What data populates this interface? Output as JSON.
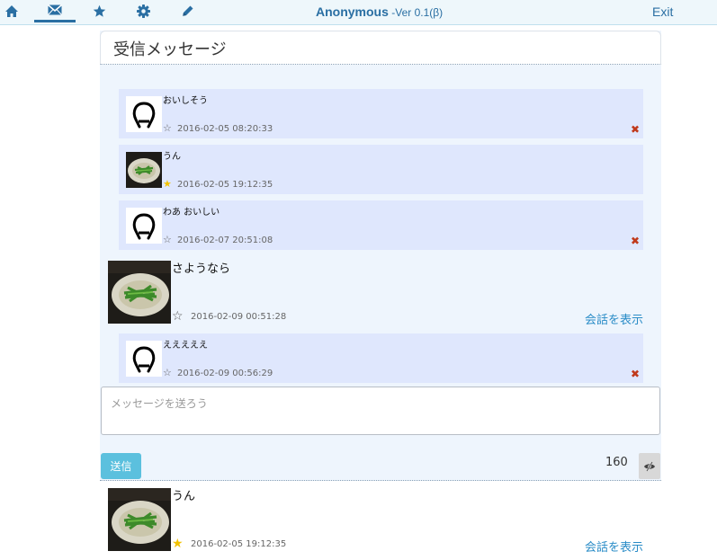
{
  "nav": {
    "icons": [
      "home-icon",
      "mail-icon",
      "star-icon",
      "gear-icon",
      "pencil-icon"
    ],
    "brand": "Anonymous",
    "version": " -Ver 0.1(β)",
    "exit": "Exit"
  },
  "panel": {
    "title": "受信メッセージ"
  },
  "thread": {
    "replies": [
      {
        "text": "おいしそう",
        "date": "2016-02-05 08:20:33",
        "starred": false,
        "deletable": true,
        "avatar": "silhouette"
      },
      {
        "text": "うん",
        "date": "2016-02-05 19:12:35",
        "starred": true,
        "deletable": false,
        "avatar": "photo"
      },
      {
        "text": "わあ おいしい",
        "date": "2016-02-07 20:51:08",
        "starred": false,
        "deletable": true,
        "avatar": "silhouette"
      }
    ],
    "main": {
      "text": "さようなら",
      "date": "2016-02-09 00:51:28",
      "starred": false,
      "link": "会話を表示"
    },
    "last_reply": {
      "text": "えええええ",
      "date": "2016-02-09 00:56:29",
      "starred": false,
      "deletable": true,
      "avatar": "silhouette"
    }
  },
  "compose": {
    "placeholder": "メッセージを送ろう",
    "send": "送信",
    "counter": "160"
  },
  "bottom_message": {
    "text": "うん",
    "date": "2016-02-05 19:12:35",
    "starred": true,
    "link": "会話を表示"
  },
  "colors": {
    "accent": "#2a6fa3",
    "link": "#2a8cc7",
    "reply_bg": "#dfe7fd",
    "panel_bg": "#eef5fd",
    "send": "#5bc0de",
    "delete": "#c0391b",
    "star": "#f2c200"
  }
}
